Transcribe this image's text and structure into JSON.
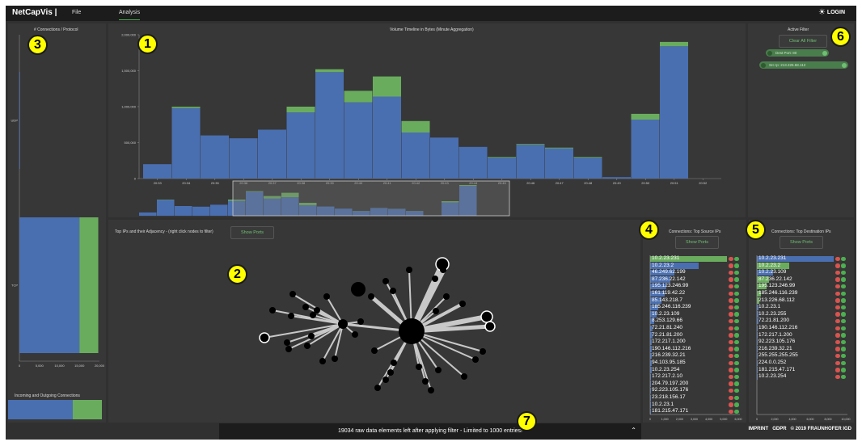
{
  "header": {
    "brand": "NetCapVis |",
    "menu": [
      "File",
      "Analysis"
    ],
    "login": "LOGIN"
  },
  "colors": {
    "blue": "#4a6fb0",
    "green": "#6aac5e",
    "bg": "#303030"
  },
  "timeline": {
    "title": "Volume Timeline in Bytes (Minute Aggregation)",
    "chart_data": {
      "type": "bar",
      "stacked": true,
      "ylabel": "",
      "ytick_labels": [
        "0",
        "500,000",
        "1,000,000",
        "1,500,000",
        "2,000,000"
      ],
      "ylim": [
        0,
        2000000
      ],
      "categories": [
        "20:33",
        "",
        "20:34",
        "",
        "20:35",
        "",
        "20:36",
        "",
        "20:37",
        "",
        "20:38",
        "",
        "20:39",
        "",
        "20:40",
        "",
        "20:41",
        "",
        "20:42",
        "",
        "20:43",
        "",
        "20:44",
        "",
        "20:45",
        "",
        "20:46",
        "",
        "20:47",
        "",
        "20:48",
        "",
        "20:49",
        "",
        "20:50",
        "",
        "20:51",
        "",
        "20:52"
      ],
      "xtick_labels": [
        "20:33",
        "20:34",
        "20:35",
        "20:36",
        "20:37",
        "20:38",
        "20:39",
        "20:40",
        "20:41",
        "20:42",
        "20:43",
        "20:44",
        "20:45",
        "20:46",
        "20:47",
        "20:48",
        "20:49",
        "20:50",
        "20:51",
        "20:52"
      ],
      "bins": [
        {
          "blue": 200000,
          "green": 0
        },
        {
          "blue": 980000,
          "green": 20000
        },
        {
          "blue": 600000,
          "green": 0
        },
        {
          "blue": 560000,
          "green": 0
        },
        {
          "blue": 680000,
          "green": 0
        },
        {
          "blue": 920000,
          "green": 80000
        },
        {
          "blue": 1480000,
          "green": 40000
        },
        {
          "blue": 1060000,
          "green": 160000
        },
        {
          "blue": 1140000,
          "green": 280000
        },
        {
          "blue": 640000,
          "green": 160000
        },
        {
          "blue": 570000,
          "green": 0
        },
        {
          "blue": 440000,
          "green": 0
        },
        {
          "blue": 290000,
          "green": 10000
        },
        {
          "blue": 470000,
          "green": 10000
        },
        {
          "blue": 420000,
          "green": 10000
        },
        {
          "blue": 290000,
          "green": 10000
        },
        {
          "blue": 20000,
          "green": 0
        },
        {
          "blue": 820000,
          "green": 80000
        },
        {
          "blue": 1840000,
          "green": 60000
        },
        {
          "blue": 0,
          "green": 0
        }
      ]
    }
  },
  "adjacency": {
    "title": "Top IPs and their Adjacency - (right click nodes to filter)",
    "show_ports": "Show Ports"
  },
  "protocol": {
    "title": "# Connections / Protocol",
    "chart_data": {
      "type": "bar",
      "orientation": "horizontal",
      "stacked": true,
      "categories": [
        "UDP",
        "TCP"
      ],
      "series": [
        {
          "values": [
            60,
            15000
          ]
        },
        {
          "values": [
            0,
            4700
          ]
        }
      ],
      "xlim": [
        0,
        20000
      ],
      "xtick_labels": [
        "0",
        "5,000",
        "10,000",
        "15,000",
        "20,000"
      ]
    },
    "io_title": "Incoming and Outgoing Connections"
  },
  "sources": {
    "title": "Connections: Top Source IPs",
    "show_ports": "Show Ports",
    "xtick_labels": [
      "0",
      "1,000",
      "2,000",
      "3,000",
      "4,000",
      "5,000",
      "6,000"
    ],
    "items": [
      {
        "ip": "10.2.23.231",
        "blue": 0.95,
        "green": 0.95
      },
      {
        "ip": "10.2.23.2",
        "blue": 0.6,
        "green": 0.0
      },
      {
        "ip": "46.249.62.199",
        "blue": 0.3,
        "green": 0.0
      },
      {
        "ip": "87.236.22.142",
        "blue": 0.25,
        "green": 0.0
      },
      {
        "ip": "195.123.246.99",
        "blue": 0.2,
        "green": 0.0
      },
      {
        "ip": "161.119.42.22",
        "blue": 0.18,
        "green": 0.0
      },
      {
        "ip": "85.143.218.7",
        "blue": 0.14,
        "green": 0.0
      },
      {
        "ip": "185.246.116.239",
        "blue": 0.1,
        "green": 0.0
      },
      {
        "ip": "10.2.23.109",
        "blue": 0.08,
        "green": 0.0
      },
      {
        "ip": "8.253.129.66",
        "blue": 0.05,
        "green": 0.0
      },
      {
        "ip": "72.21.81.240",
        "blue": 0.03,
        "green": 0.0
      },
      {
        "ip": "72.21.81.200",
        "blue": 0.03,
        "green": 0.0
      },
      {
        "ip": "172.217.1.200",
        "blue": 0.02,
        "green": 0.0
      },
      {
        "ip": "190.146.112.216",
        "blue": 0.02,
        "green": 0.0
      },
      {
        "ip": "216.239.32.21",
        "blue": 0.02,
        "green": 0.0
      },
      {
        "ip": "94.103.95.185",
        "blue": 0.02,
        "green": 0.0
      },
      {
        "ip": "10.2.23.254",
        "blue": 0.02,
        "green": 0.0
      },
      {
        "ip": "172.217.2.10",
        "blue": 0.01,
        "green": 0.0
      },
      {
        "ip": "204.79.197.200",
        "blue": 0.01,
        "green": 0.0
      },
      {
        "ip": "92.223.105.176",
        "blue": 0.01,
        "green": 0.0
      },
      {
        "ip": "23.218.156.17",
        "blue": 0.01,
        "green": 0.0
      },
      {
        "ip": "10.2.23.1",
        "blue": 0.01,
        "green": 0.0
      },
      {
        "ip": "181.215.47.171",
        "blue": 0.01,
        "green": 0.0
      }
    ]
  },
  "destinations": {
    "title": "Connections: Top Destination IPs",
    "show_ports": "Show Ports",
    "xtick_labels": [
      "0",
      "2,000",
      "4,000",
      "6,000",
      "8,000",
      "10,000"
    ],
    "items": [
      {
        "ip": "10.2.23.231",
        "blue": 0.95,
        "green": 0.0
      },
      {
        "ip": "10.2.23.2",
        "blue": 0.0,
        "green": 0.4
      },
      {
        "ip": "10.2.23.109",
        "blue": 0.2,
        "green": 0.0
      },
      {
        "ip": "87.236.22.142",
        "blue": 0.0,
        "green": 0.15
      },
      {
        "ip": "195.123.246.99",
        "blue": 0.0,
        "green": 0.12
      },
      {
        "ip": "185.246.116.239",
        "blue": 0.0,
        "green": 0.05
      },
      {
        "ip": "213.226.68.112",
        "blue": 0.0,
        "green": 0.03
      },
      {
        "ip": "10.2.23.1",
        "blue": 0.02,
        "green": 0.0
      },
      {
        "ip": "10.2.23.255",
        "blue": 0.02,
        "green": 0.0
      },
      {
        "ip": "72.21.81.200",
        "blue": 0.02,
        "green": 0.0
      },
      {
        "ip": "190.146.112.216",
        "blue": 0.01,
        "green": 0.0
      },
      {
        "ip": "172.217.1.200",
        "blue": 0.01,
        "green": 0.0
      },
      {
        "ip": "92.223.105.176",
        "blue": 0.01,
        "green": 0.0
      },
      {
        "ip": "216.239.32.21",
        "blue": 0.01,
        "green": 0.0
      },
      {
        "ip": "255.255.255.255",
        "blue": 0.01,
        "green": 0.0
      },
      {
        "ip": "224.0.0.252",
        "blue": 0.01,
        "green": 0.0
      },
      {
        "ip": "181.215.47.171",
        "blue": 0.01,
        "green": 0.0
      },
      {
        "ip": "10.2.23.254",
        "blue": 0.01,
        "green": 0.0
      }
    ]
  },
  "filters": {
    "title": "Active Filter",
    "clear_label": "Clear All Filter",
    "chips": [
      "Dest Port: 80",
      "Src Ip: 213.226.68.112"
    ]
  },
  "footer": {
    "text": "19034 raw data elements left after applying filter - Limited to 1000 entries!",
    "imprint": "IMPRINT",
    "gdpr": "GDPR",
    "copyright": "© 2019 FRAUNHOFER IGD"
  },
  "markers": [
    "1",
    "2",
    "3",
    "4",
    "5",
    "6",
    "7"
  ]
}
